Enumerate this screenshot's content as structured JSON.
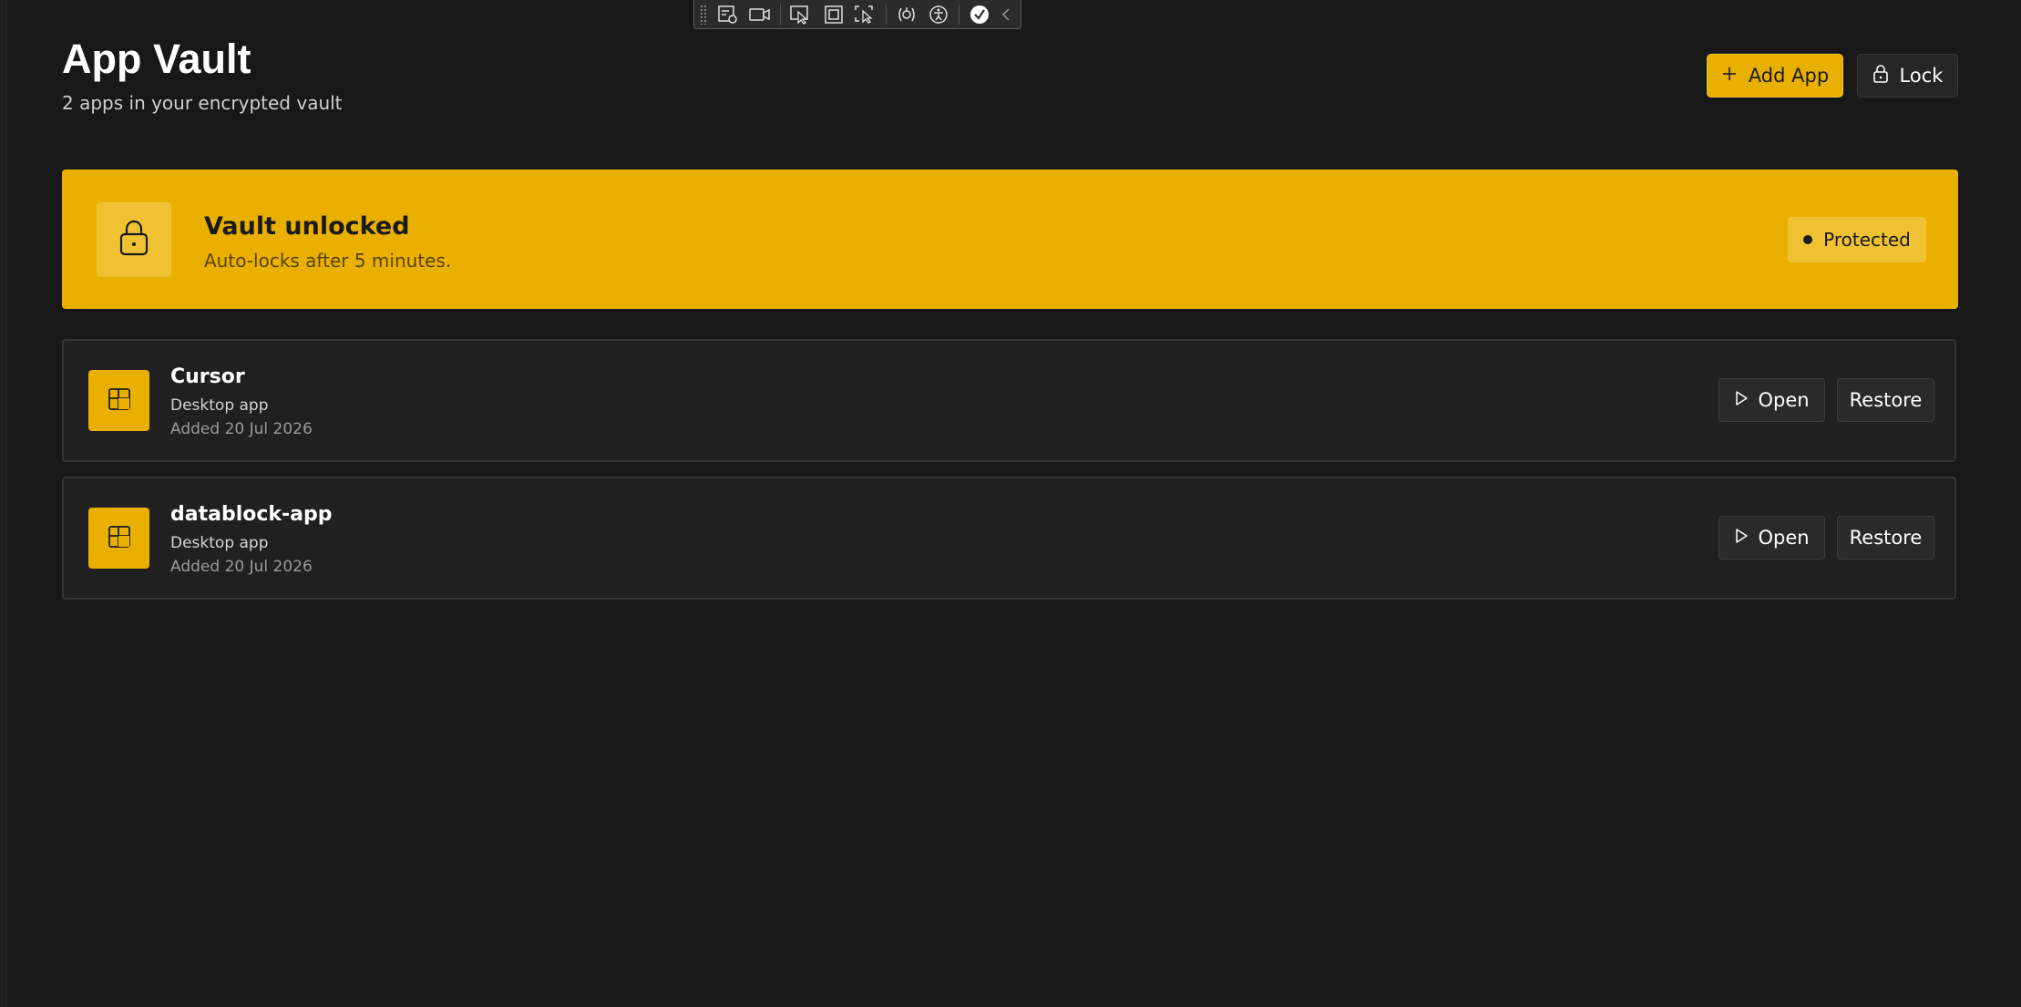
{
  "header": {
    "title": "App Vault",
    "subtitle": "2 apps in your encrypted vault",
    "add_button_label": "Add App",
    "lock_button_label": "Lock"
  },
  "banner": {
    "title": "Vault unlocked",
    "description": "Auto-locks after 5 minutes.",
    "badge_label": "Protected"
  },
  "apps": [
    {
      "name": "Cursor",
      "type": "Desktop app",
      "added": "Added 20 Jul 2026",
      "open_label": "Open",
      "restore_label": "Restore"
    },
    {
      "name": "datablock-app",
      "type": "Desktop app",
      "added": "Added 20 Jul 2026",
      "open_label": "Open",
      "restore_label": "Restore"
    }
  ],
  "colors": {
    "accent": "#eab000",
    "background": "#181818",
    "card": "#202020"
  },
  "icons": {
    "toolbar": [
      "live-visual-tree-icon",
      "video-icon",
      "select-element-icon",
      "display-layout-adorners-icon",
      "track-focus-icon",
      "hot-reload-icon",
      "accessibility-icon",
      "binding-check-icon",
      "collapse-chevron-icon"
    ],
    "banner": "lock-open-icon",
    "app": "app-layout-icon"
  }
}
